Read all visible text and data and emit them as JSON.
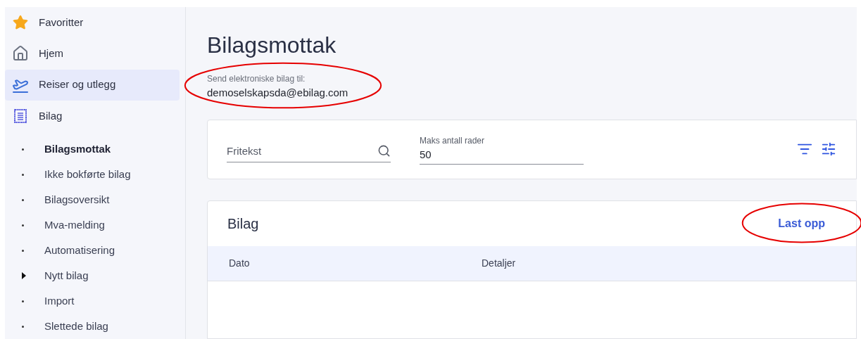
{
  "sidebar": {
    "items": [
      {
        "label": "Favoritter",
        "kind": "star",
        "selected": false
      },
      {
        "label": "Hjem",
        "kind": "home",
        "selected": false
      },
      {
        "label": "Reiser og utlegg",
        "kind": "travel",
        "selected": true
      },
      {
        "label": "Bilag",
        "kind": "voucher",
        "selected": false
      }
    ],
    "subitems": [
      {
        "label": "Bilagsmottak",
        "kind": "link",
        "selected": true
      },
      {
        "label": "Ikke bokførte bilag",
        "kind": "link",
        "selected": false
      },
      {
        "label": "Bilagsoversikt",
        "kind": "link",
        "selected": false
      },
      {
        "label": "Mva-melding",
        "kind": "link",
        "selected": false
      },
      {
        "label": "Automatisering",
        "kind": "link",
        "selected": false
      },
      {
        "label": "Nytt bilag",
        "kind": "group",
        "selected": false
      },
      {
        "label": "Import",
        "kind": "link",
        "selected": false
      },
      {
        "label": "Slettede bilag",
        "kind": "link",
        "selected": false
      }
    ]
  },
  "page": {
    "title": "Bilagsmottak",
    "email_label": "Send elektroniske bilag til:",
    "email": "demoselskapsda@ebilag.com",
    "email_highlighted": true
  },
  "filters": {
    "search": {
      "placeholder": "Fritekst"
    },
    "max_rows": {
      "label": "Maks antall rader",
      "value": "50"
    }
  },
  "bilag": {
    "title": "Bilag",
    "upload_button": "Last opp",
    "upload_highlighted": true,
    "columns": [
      "Dato",
      "Detaljer"
    ]
  }
}
